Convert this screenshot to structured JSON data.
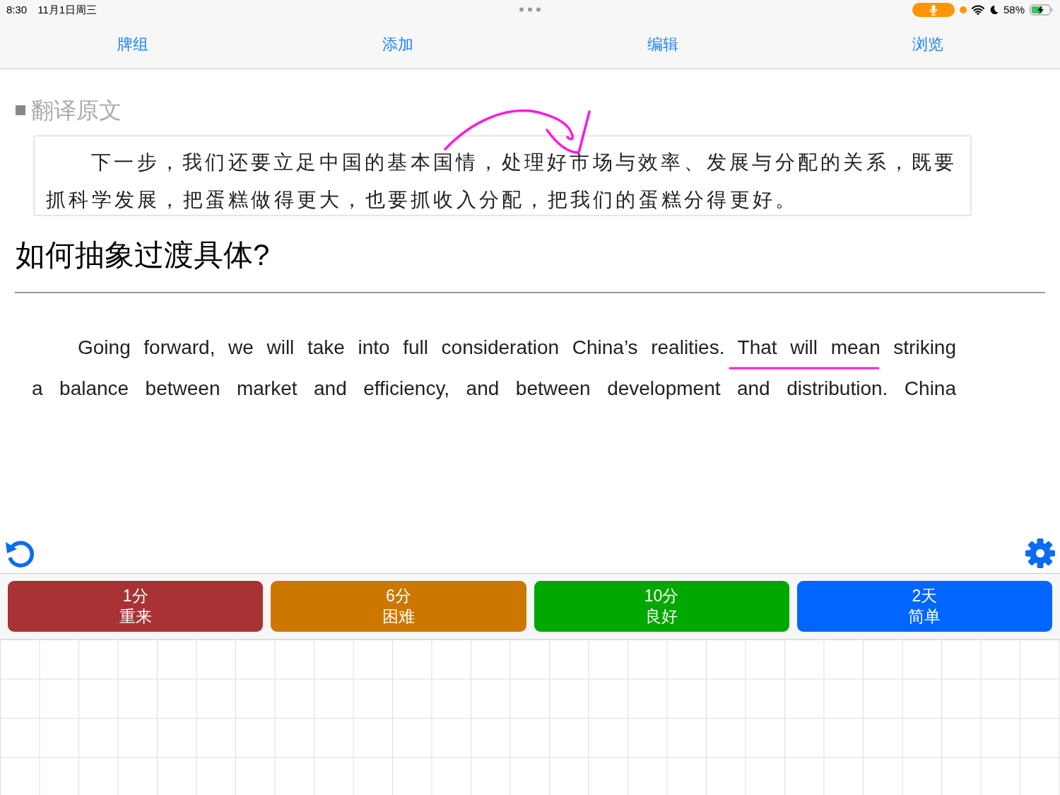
{
  "status_bar": {
    "time": "8:30",
    "date": "11月1日周三",
    "battery": "58%"
  },
  "tabs": [
    {
      "label": "牌组"
    },
    {
      "label": "添加"
    },
    {
      "label": "编辑"
    },
    {
      "label": "浏览"
    }
  ],
  "card": {
    "section_title": "翻译原文",
    "source_text": "下一步，我们还要立足中国的基本国情，处理好市场与效率、发展与分配的关系，既要抓科学发展，把蛋糕做得更大，也要抓收入分配，把我们的蛋糕分得更好。",
    "question": "如何抽象过渡具体?",
    "answer_lines": [
      "Going forward, we will take into full consideration China’s realities. That will mean striking",
      "a balance between market and efficiency, and between development and distribution. China"
    ]
  },
  "answer_buttons": [
    {
      "interval": "1分",
      "label": "重来",
      "color": "#a83234"
    },
    {
      "interval": "6分",
      "label": "困难",
      "color": "#cc7700"
    },
    {
      "interval": "10分",
      "label": "良好",
      "color": "#00a800"
    },
    {
      "interval": "2天",
      "label": "简单",
      "color": "#0066ff"
    }
  ]
}
